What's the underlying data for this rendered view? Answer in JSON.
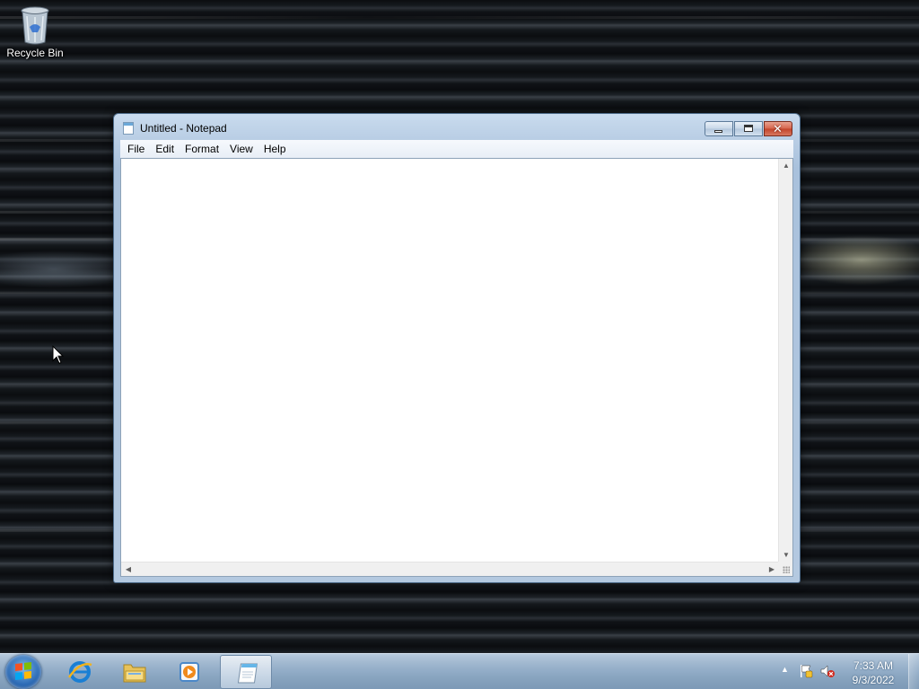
{
  "desktop": {
    "icons": [
      {
        "label": "Recycle Bin",
        "icon": "recycle-bin-icon"
      }
    ]
  },
  "window": {
    "title": "Untitled - Notepad",
    "icon": "notepad-icon",
    "controls": [
      "minimize-icon",
      "maximize-icon",
      "close-icon"
    ],
    "menu": [
      "File",
      "Edit",
      "Format",
      "View",
      "Help"
    ],
    "text": ""
  },
  "taskbar": {
    "start_icon": "windows-logo-icon",
    "pinned": [
      {
        "icon": "internet-explorer-icon"
      },
      {
        "icon": "windows-explorer-icon"
      },
      {
        "icon": "media-player-icon"
      },
      {
        "icon": "notepad-icon",
        "active": true
      }
    ],
    "tray": {
      "icons": [
        "show-hidden-icons-arrow",
        "action-center-flag-icon",
        "volume-muted-icon"
      ],
      "time": "7:33 AM",
      "date": "9/3/2022"
    }
  },
  "colors": {
    "taskbar": "#96b2ce",
    "window_frame": "#b8cde4",
    "close_button": "#c1432a",
    "accent": "#2a69b4"
  }
}
